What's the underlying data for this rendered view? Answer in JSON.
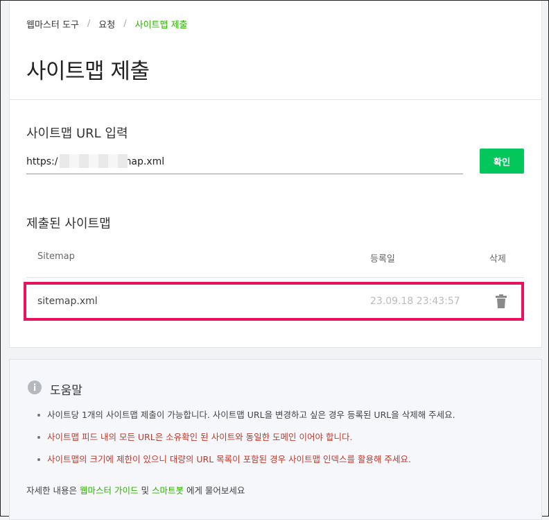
{
  "breadcrumb": {
    "items": [
      "웹마스터 도구",
      "요청",
      "사이트맵 제출"
    ],
    "separator": "/"
  },
  "page_title": "사이트맵 제출",
  "url_section": {
    "label": "사이트맵 URL 입력",
    "input_prefix": "https:/",
    "input_suffix": "/sitemap.xml",
    "submit_label": "확인"
  },
  "submitted_section": {
    "label": "제출된 사이트맵",
    "columns": [
      "Sitemap",
      "등록일",
      "삭제"
    ],
    "rows": [
      {
        "name": "sitemap.xml",
        "date": "23.09.18 23:43:57"
      }
    ]
  },
  "help": {
    "title": "도움말",
    "items": [
      "사이트당 1개의 사이트맵 제출이 가능합니다. 사이트맵 URL을 변경하고 싶은 경우 등록된 URL을 삭제해 주세요.",
      "사이트맵 피드 내의 모든 URL은 소유확인 된 사이트와 동일한 도메인 이어야 합니다.",
      "사이트맵의 크기에 제한이 있으니 대량의 URL 목록이 포함된 경우 사이트맵 인덱스를 활용해 주세요."
    ],
    "more_prefix": "자세한 내용은",
    "link1": "웹마스터 가이드",
    "and": "및",
    "link2": "스마트봇",
    "more_suffix": "에게 물어보세요"
  },
  "colors": {
    "accent_green": "#03c75a",
    "breadcrumb_active": "#2db400",
    "highlight_border": "#e8135f",
    "warning_text": "#c0392b"
  },
  "icons": [
    "trash-icon",
    "info-icon"
  ]
}
